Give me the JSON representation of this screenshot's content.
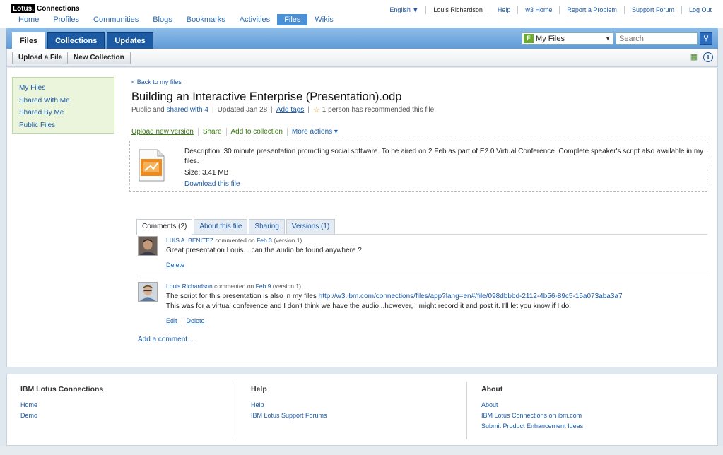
{
  "logo": {
    "part1": "Lotus.",
    "part2": "Connections"
  },
  "mainnav": [
    "Home",
    "Profiles",
    "Communities",
    "Blogs",
    "Bookmarks",
    "Activities",
    "Files",
    "Wikis"
  ],
  "utilnav": {
    "language": "English ▼",
    "user": "Louis Richardson",
    "help": "Help",
    "w3home": "w3 Home",
    "report": "Report a Problem",
    "forum": "Support Forum",
    "logout": "Log Out"
  },
  "apptabs": [
    "Files",
    "Collections",
    "Updates"
  ],
  "search": {
    "scope": "My Files",
    "placeholder": "Search"
  },
  "toolbar": {
    "upload": "Upload a File",
    "new_collection": "New Collection"
  },
  "leftnav": [
    "My Files",
    "Shared With Me",
    "Shared By Me",
    "Public Files"
  ],
  "file": {
    "back": "< Back to my files",
    "title": "Building an Interactive Enterprise (Presentation).odp",
    "meta_public": "Public and",
    "meta_shared": "shared with 4",
    "meta_updated": "Updated Jan 28",
    "meta_tags": "Add tags",
    "meta_recommended": "1 person has recommended this file.",
    "actions": {
      "upload": "Upload new version",
      "share": "Share",
      "add": "Add to collection",
      "more": "More actions ▾"
    },
    "description": "Description: 30 minute presentation promoting social software. To be aired on 2 Feb as part of E2.0 Virtual Conference. Complete speaker's script also available in my files.",
    "size": "Size: 3.41 MB",
    "download": "Download this file"
  },
  "ctabs": [
    "Comments (2)",
    "About this file",
    "Sharing",
    "Versions (1)"
  ],
  "comments": [
    {
      "author": "LUIS A. BENITEZ",
      "commented": "commented on",
      "date": "Feb 3",
      "version": "(version 1)",
      "text1": "Great presentation Louis... can the audio be found anywhere ?",
      "links": [
        "Delete"
      ]
    },
    {
      "author": "Louis Richardson",
      "commented": "commented on",
      "date": "Feb 9",
      "version": "(version 1)",
      "text1_prefix": "The script for this presentation is also in my files",
      "text1_link": "http://w3.ibm.com/connections/files/app?lang=en#/file/098dbbbd-2112-4b56-89c5-15a073aba3a7",
      "text2": "This was for a virtual conference and I don't think we have the audio...however, I might record it and post it. I'll let you know if I do.",
      "links": [
        "Edit",
        "Delete"
      ]
    }
  ],
  "add_comment": "Add a comment...",
  "footer": {
    "col1": {
      "title": "IBM Lotus Connections",
      "links": [
        "Home",
        "Demo"
      ]
    },
    "col2": {
      "title": "Help",
      "links": [
        "Help",
        "IBM Lotus Support Forums"
      ]
    },
    "col3": {
      "title": "About",
      "links": [
        "About",
        "IBM Lotus Connections on ibm.com",
        "Submit Product Enhancement Ideas"
      ]
    }
  }
}
